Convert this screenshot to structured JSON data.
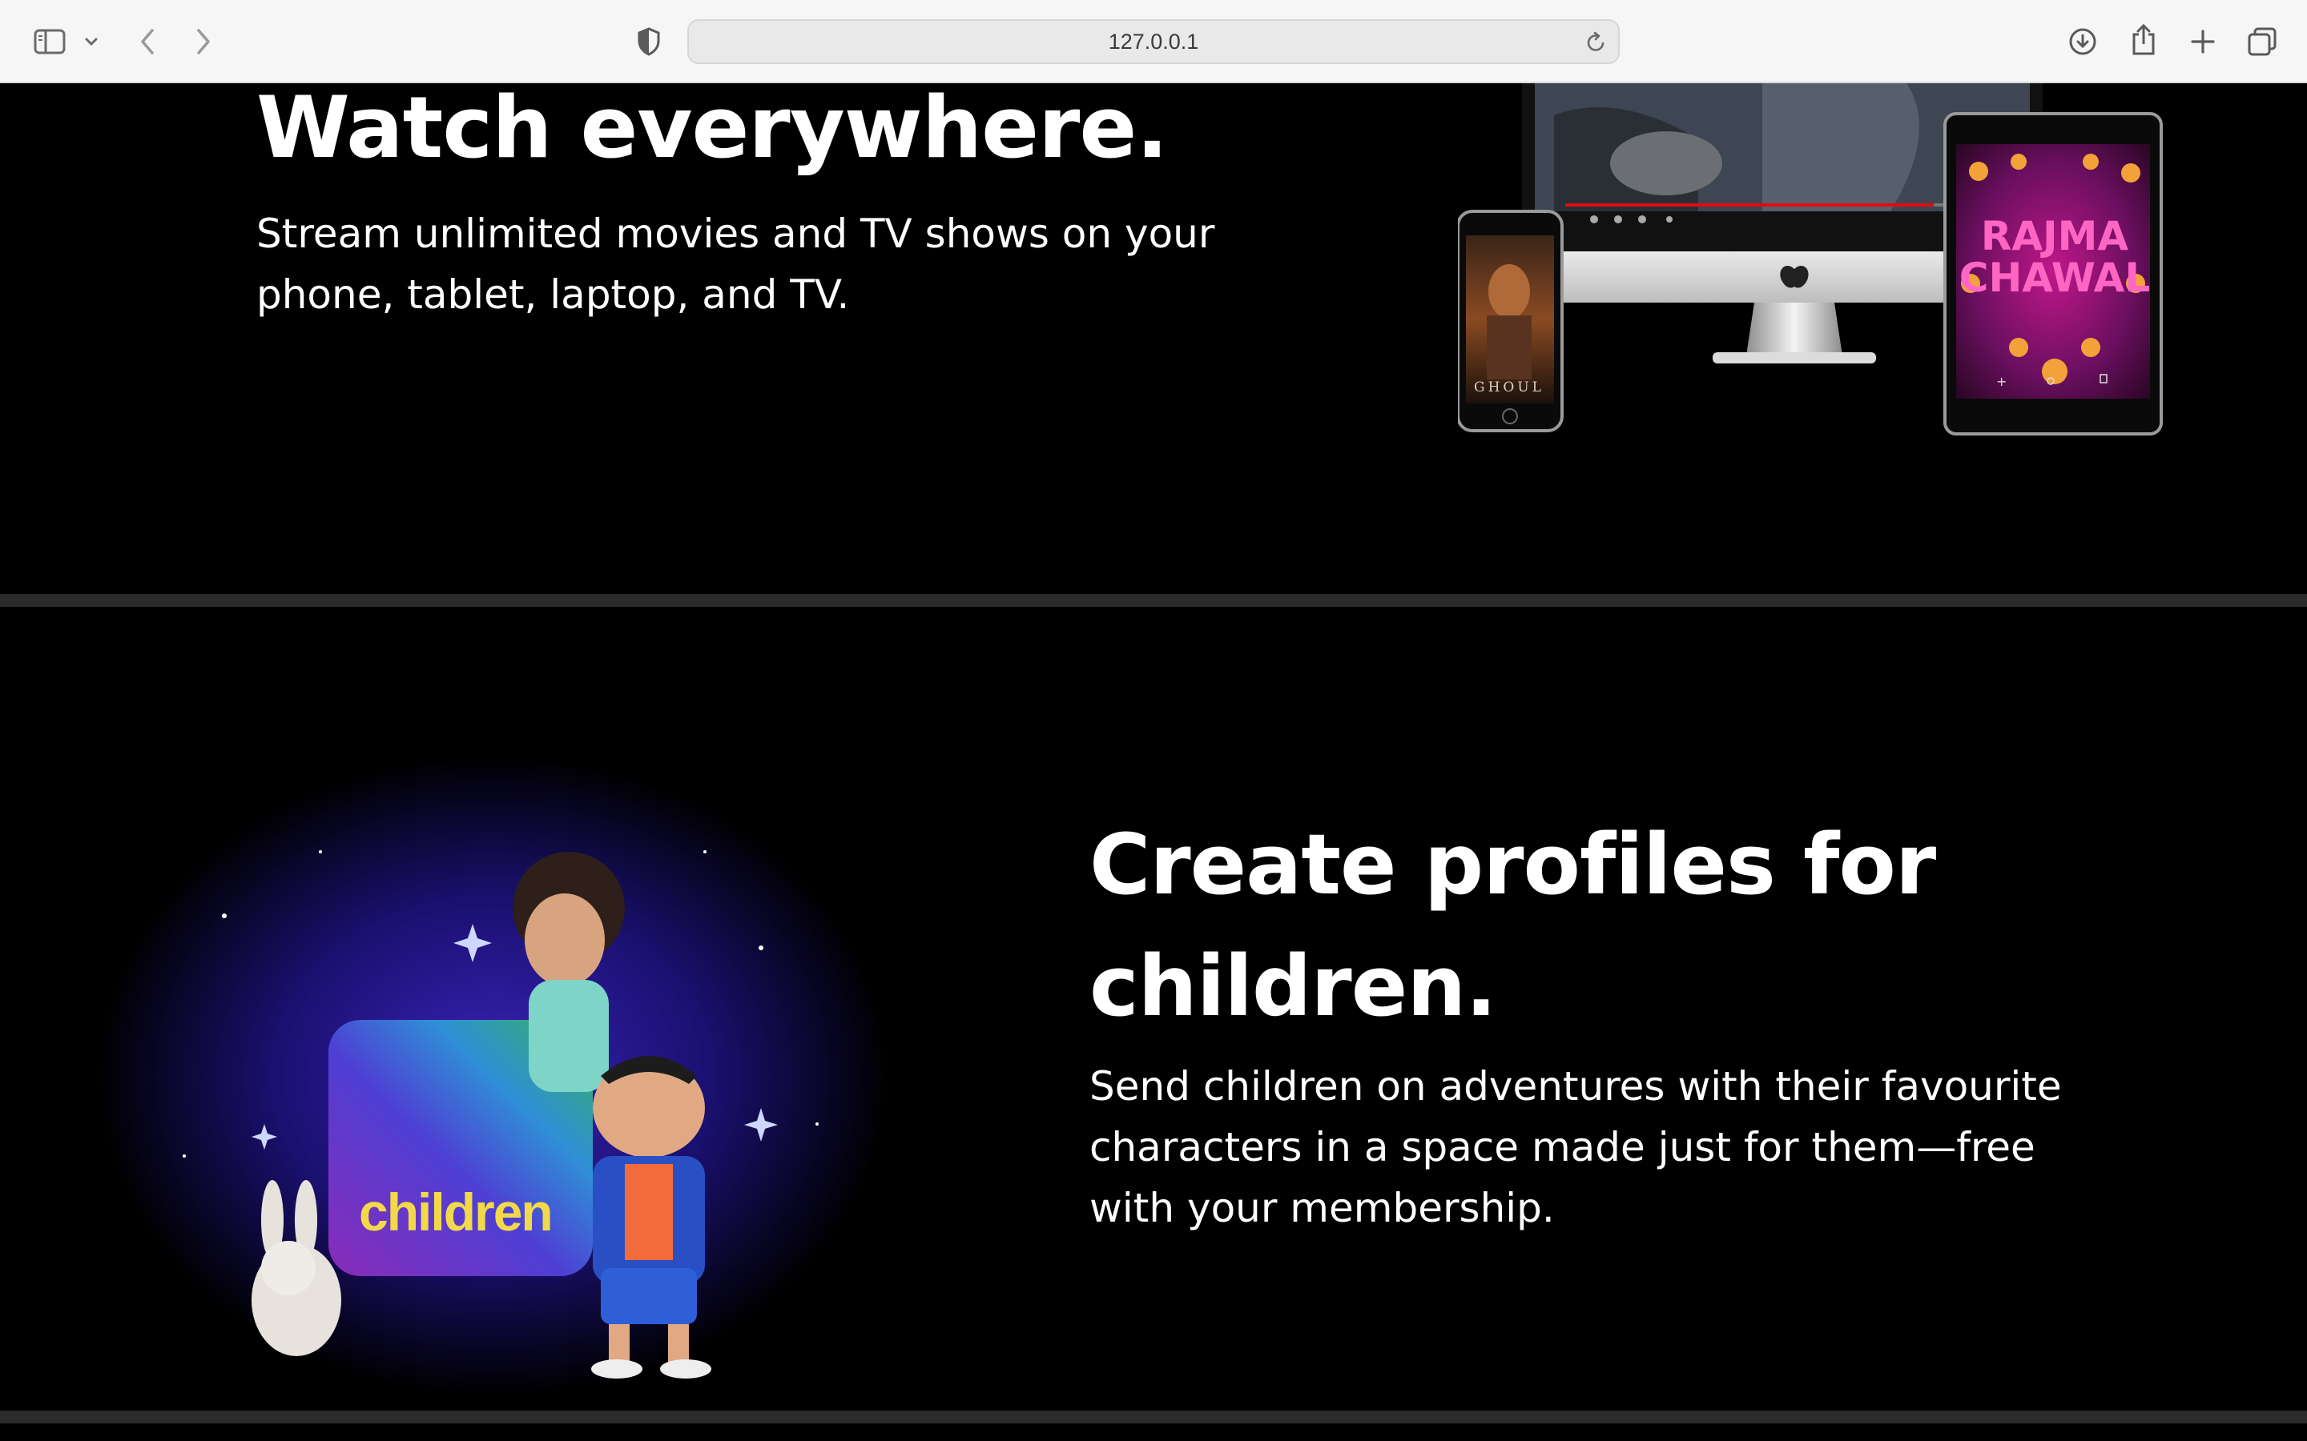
{
  "browser": {
    "url": "127.0.0.1",
    "icons": {
      "sidebar": "sidebar-icon",
      "chevron": "chevron-down-icon",
      "back": "back-arrow-icon",
      "forward": "forward-arrow-icon",
      "shield": "privacy-shield-icon",
      "reload": "reload-icon",
      "download": "download-icon",
      "share": "share-icon",
      "new_tab": "plus-icon",
      "tabs": "tab-overview-icon"
    }
  },
  "section_watch": {
    "title": "Watch everywhere.",
    "text": "Stream unlimited movies and TV shows on your phone, tablet, laptop, and TV.",
    "phone_poster_text": "GHOUL",
    "tablet_poster_line1": "RAJMA",
    "tablet_poster_line2": "CHAWAL"
  },
  "section_kids": {
    "title": "Create profiles for children.",
    "text": "Send children on adventures with their favourite characters in a space made just for them—free with your membership.",
    "badge_label": "children"
  },
  "colors": {
    "background": "#000000",
    "divider": "#2b2b2b",
    "text": "#ffffff",
    "kids_label": "#f2d94a",
    "accent_red": "#e50914"
  }
}
